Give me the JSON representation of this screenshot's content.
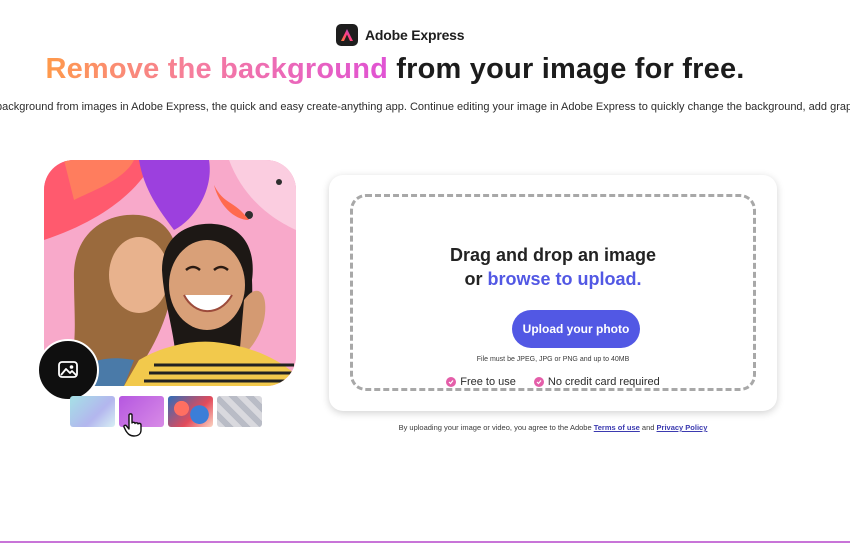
{
  "brand": {
    "name": "Adobe Express"
  },
  "headline": {
    "gradient_part": "Remove the background",
    "rest": " from your image for free."
  },
  "subtext": "background from images in Adobe Express, the quick and easy create-anything app. Continue editing your image in Adobe Express to quickly change the background, add graphics, and r",
  "upload": {
    "title_line1": "Drag and drop an image",
    "title_line2_prefix": "or ",
    "browse_link": "browse to upload.",
    "button_label": "Upload your photo",
    "file_note": "File must be JPEG, JPG or PNG and up to 40MB",
    "features": [
      "Free to use",
      "No credit card required"
    ]
  },
  "terms": {
    "prefix": "By uploading your image or video, you agree to the Adobe ",
    "terms_link": "Terms of use",
    "and": " and ",
    "privacy_link": "Privacy Policy"
  },
  "colors": {
    "accent": "#5258e4",
    "check": "#e45ea9",
    "gradient_start": "#ff9a4a",
    "gradient_end": "#e052d4"
  },
  "icons": {
    "brand": "adobe-express-icon",
    "image_badge": "image-icon",
    "cursor": "hand-pointer-icon",
    "feature_check": "check-icon"
  }
}
